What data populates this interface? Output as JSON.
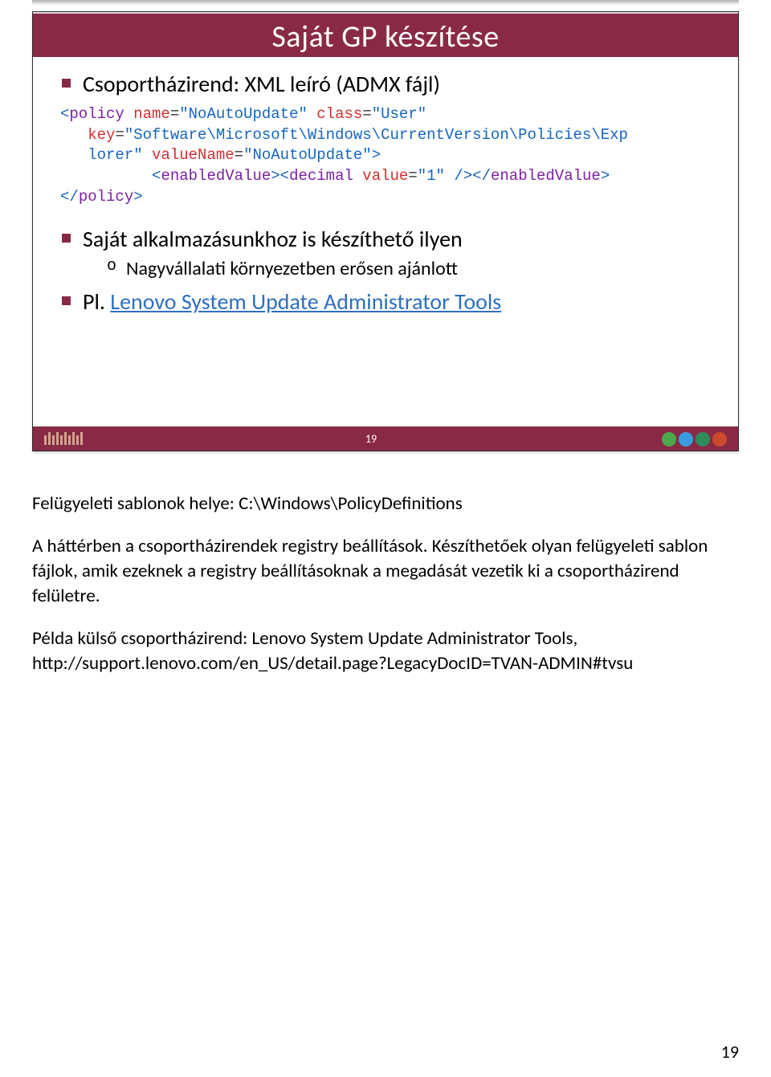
{
  "slide": {
    "title": "Saját GP készítése",
    "bullet1": "Csoportházirend: XML leíró (ADMX fájl)",
    "bullet2": "Saját alkalmazásunkhoz is készíthető ilyen",
    "bullet2_sub": "Nagyvállalati környezetben erősen ajánlott",
    "bullet3_prefix": "Pl. ",
    "bullet3_link": "Lenovo System Update Administrator Tools",
    "slide_number": "19",
    "code": {
      "line1_open": "<",
      "line1_tag": "policy",
      "line1_attr1_name": " name",
      "line1_attr1_eq": "=",
      "line1_attr1_val": "\"NoAutoUpdate\"",
      "line1_attr2_name": " class",
      "line1_attr2_eq": "=",
      "line1_attr2_val": "\"User\"",
      "line2_attr_name": "key",
      "line2_attr_eq": "=",
      "line2_attr_val": "\"Software\\Microsoft\\Windows\\CurrentVersion\\Policies\\Exp",
      "line3_cont": "lorer\"",
      "line3_attr2_name": " valueName",
      "line3_attr2_eq": "=",
      "line3_attr2_val": "\"NoAutoUpdate\"",
      "line3_close": ">",
      "line4_open1": "<",
      "line4_tag1": "enabledValue",
      "line4_close1": ">",
      "line4_open2": "<",
      "line4_tag2": "decimal",
      "line4_attr_name": " value",
      "line4_attr_eq": "=",
      "line4_attr_val": "\"1\"",
      "line4_selfclose": " />",
      "line4_open3": "</",
      "line4_tag3": "enabledValue",
      "line4_close3": ">",
      "line5_open": "</",
      "line5_tag": "policy",
      "line5_close": ">"
    }
  },
  "notes": {
    "p1": "Felügyeleti sablonok helye: C:\\Windows\\PolicyDefinitions",
    "p2": "A háttérben a csoportházirendek registry beállítások. Készíthetőek olyan felügyeleti sablon fájlok, amik ezeknek a registry beállításoknak a megadását vezetik ki a csoportházirend felületre.",
    "p3": "Példa külső csoportházirend: Lenovo System Update Administrator Tools, http://support.lenovo.com/en_US/detail.page?LegacyDocID=TVAN-ADMIN#tvsu"
  },
  "page_number": "19"
}
